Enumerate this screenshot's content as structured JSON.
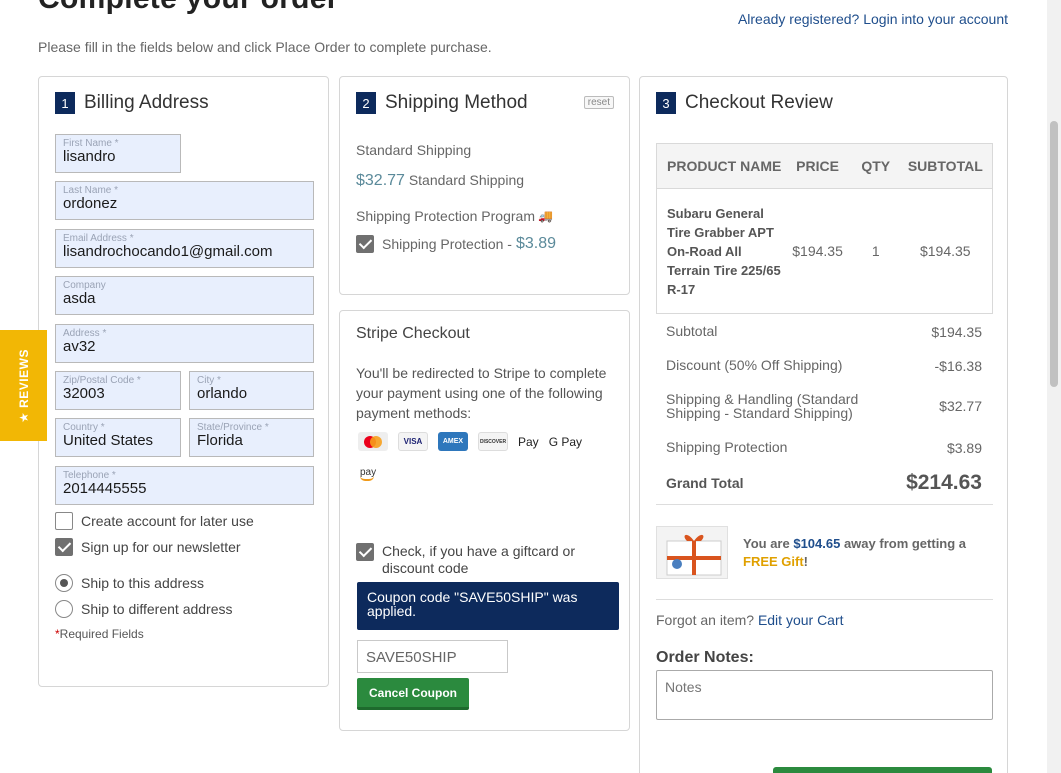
{
  "page": {
    "title": "Complete your order",
    "login_link": "Already registered? Login into your account",
    "intro": "Please fill in the fields below and click Place Order to complete purchase."
  },
  "billing": {
    "step": "1",
    "title": "Billing Address",
    "fields": {
      "first_name": {
        "label": "First Name *",
        "value": "lisandro"
      },
      "last_name": {
        "label": "Last Name *",
        "value": "ordonez"
      },
      "email": {
        "label": "Email Address *",
        "value": "lisandrochocando1@gmail.com"
      },
      "company": {
        "label": "Company",
        "value": "asda"
      },
      "address": {
        "label": "Address *",
        "value": "av32"
      },
      "zip": {
        "label": "Zip/Postal Code *",
        "value": "32003"
      },
      "city": {
        "label": "City *",
        "value": "orlando"
      },
      "country": {
        "label": "Country *",
        "value": "United States"
      },
      "state": {
        "label": "State/Province *",
        "value": "Florida"
      },
      "telephone": {
        "label": "Telephone *",
        "value": "2014445555"
      }
    },
    "create_account": {
      "label": "Create account for later use",
      "checked": false
    },
    "newsletter": {
      "label": "Sign up for our newsletter",
      "checked": true
    },
    "ship_same": {
      "label": "Ship to this address",
      "selected": true
    },
    "ship_different": {
      "label": "Ship to different address",
      "selected": false
    },
    "required_star": "*",
    "required_note": "Required Fields"
  },
  "shipping": {
    "step": "2",
    "title": "Shipping Method",
    "reset": "reset",
    "method_title": "Standard Shipping",
    "method_price": "$32.77",
    "method_name": "Standard Shipping",
    "protection_title": "Shipping Protection Program",
    "protection_label": "Shipping Protection - ",
    "protection_price": "$3.89",
    "truck_icon": "🚚"
  },
  "stripe": {
    "title": "Stripe Checkout",
    "description": "You'll be redirected to Stripe to complete your payment using one of the following payment methods:",
    "methods": {
      "visa": "VISA",
      "amex": "AMEX",
      "discover": "DISCOVER",
      "apple_pay": " Pay",
      "google_pay": "G Pay",
      "amazon_pay": "pay"
    },
    "giftcard_label": "Check, if you have a giftcard or discount code",
    "coupon_message": "Coupon code \"SAVE50SHIP\" was applied.",
    "coupon_value": "SAVE50SHIP",
    "cancel_coupon": "Cancel Coupon"
  },
  "review": {
    "step": "3",
    "title": "Checkout Review",
    "columns": [
      "PRODUCT NAME",
      "PRICE",
      "QTY",
      "SUBTOTAL"
    ],
    "item": {
      "name": "Subaru General Tire Grabber APT On-Road All Terrain Tire 225/65 R-17",
      "price": "$194.35",
      "qty": "1",
      "subtotal": "$194.35"
    },
    "totals": {
      "subtotal": {
        "label": "Subtotal",
        "value": "$194.35"
      },
      "discount": {
        "label": "Discount (50% Off Shipping)",
        "value": "-$16.38"
      },
      "shipping": {
        "label": "Shipping & Handling (Standard Shipping - Standard Shipping)",
        "value": "$32.77"
      },
      "protection": {
        "label": "Shipping Protection",
        "value": "$3.89"
      },
      "grand": {
        "label": "Grand Total",
        "value": "$214.63"
      }
    },
    "gift": {
      "prefix": "You are ",
      "amount": "$104.65",
      "middle": " away from getting a ",
      "free": "FREE Gift",
      "suffix": "!"
    },
    "forgot_text": "Forgot an item? ",
    "edit_cart": "Edit your Cart",
    "notes_label": "Order Notes:",
    "notes_placeholder": "Notes"
  },
  "reviews_tab": "★ REVIEWS",
  "colors": {
    "navy": "#0d2a5c",
    "green": "#2b8a3e",
    "link": "#1f4e8c",
    "gold": "#f2b705"
  }
}
